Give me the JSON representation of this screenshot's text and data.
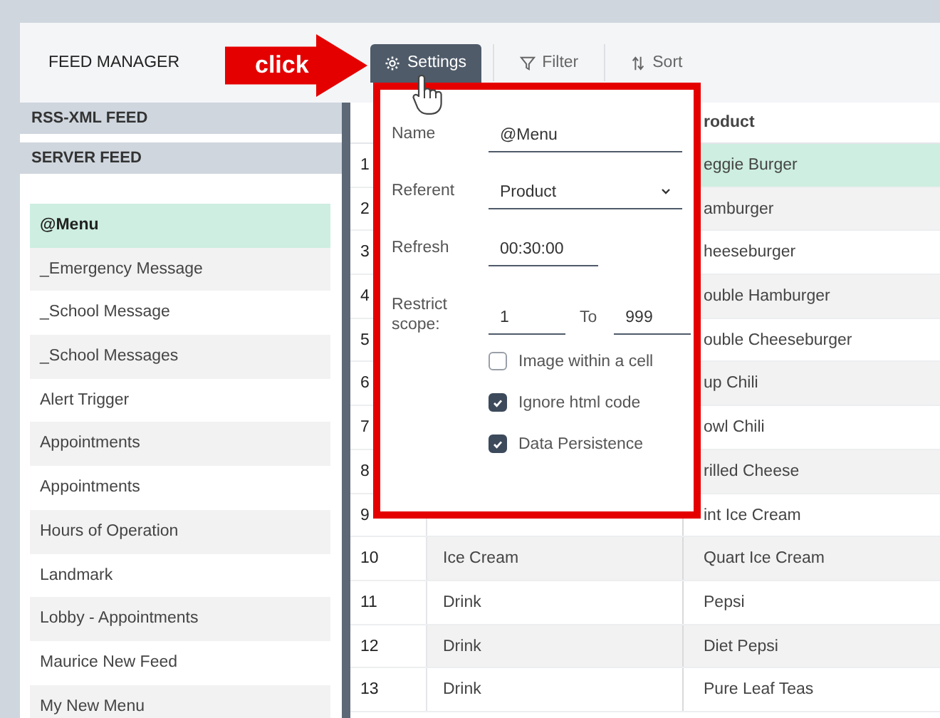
{
  "header": {
    "title": "FEED MANAGER",
    "toolbar": [
      {
        "label": "Settings",
        "kind": "gear",
        "selected": true
      },
      {
        "label": "Filter",
        "kind": "filter",
        "selected": false
      },
      {
        "label": "Sort",
        "kind": "sort",
        "selected": false
      }
    ]
  },
  "sidebar": {
    "sections": [
      {
        "label": "RSS-XML FEED"
      },
      {
        "label": "SERVER FEED"
      }
    ],
    "items": [
      {
        "label": "@Menu",
        "selected": true
      },
      {
        "label": "_Emergency Message",
        "selected": false
      },
      {
        "label": "_School Message",
        "selected": false
      },
      {
        "label": "_School Messages",
        "selected": false
      },
      {
        "label": "Alert Trigger",
        "selected": false
      },
      {
        "label": "Appointments",
        "selected": false
      },
      {
        "label": "Appointments",
        "selected": false
      },
      {
        "label": "Hours of Operation",
        "selected": false
      },
      {
        "label": "Landmark",
        "selected": false
      },
      {
        "label": "Lobby - Appointments",
        "selected": false
      },
      {
        "label": "Maurice New Feed",
        "selected": false
      },
      {
        "label": "My New Menu",
        "selected": false
      }
    ]
  },
  "table": {
    "product_header": "roduct",
    "rows": [
      {
        "number": "1",
        "product": "eggie Burger",
        "selected": true
      },
      {
        "number": "2",
        "product": "amburger",
        "selected": false
      },
      {
        "number": "3",
        "product": "heeseburger",
        "selected": false
      },
      {
        "number": "4",
        "product": "ouble Hamburger",
        "selected": false
      },
      {
        "number": "5",
        "product": "ouble Cheeseburger",
        "selected": false
      },
      {
        "number": "6",
        "product": "up Chili",
        "selected": false
      },
      {
        "number": "7",
        "product": "owl Chili",
        "selected": false
      },
      {
        "number": "8",
        "product": "rilled Cheese",
        "selected": false
      },
      {
        "number": "9",
        "product": "int Ice Cream",
        "selected": false
      },
      {
        "number": "10",
        "category": "Ice Cream",
        "product": "Quart Ice Cream",
        "selected": false
      },
      {
        "number": "11",
        "category": "Drink",
        "product": "Pepsi",
        "selected": false
      },
      {
        "number": "12",
        "category": "Drink",
        "product": "Diet Pepsi",
        "selected": false
      },
      {
        "number": "13",
        "category": "Drink",
        "product": "Pure Leaf Teas",
        "selected": false
      }
    ]
  },
  "annotation": {
    "label": "click"
  },
  "settings_popup": {
    "fields": [
      {
        "kind": "text",
        "label": "Name",
        "value": "@Menu"
      },
      {
        "kind": "select",
        "label": "Referent",
        "value": "Product"
      },
      {
        "kind": "time",
        "label": "Refresh",
        "value": "00:30:00"
      },
      {
        "kind": "range",
        "label": "Restrict scope:",
        "from": "1",
        "separator": "To",
        "to": "999"
      }
    ],
    "options": [
      {
        "label": "Image within a cell",
        "checked": false
      },
      {
        "label": "Ignore html code",
        "checked": true
      },
      {
        "label": "Data Persistence",
        "checked": true
      }
    ]
  }
}
